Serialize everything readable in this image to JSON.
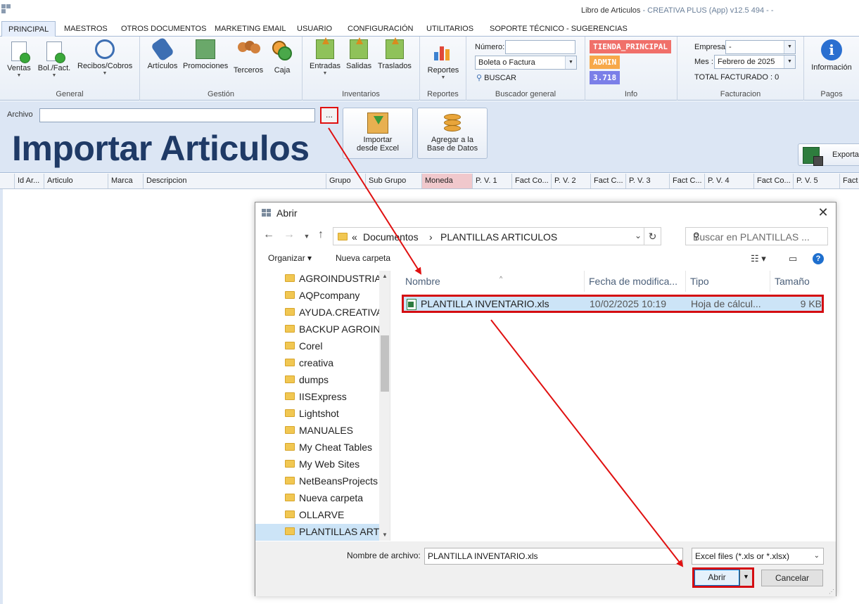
{
  "window": {
    "title": "Libro de Articulos",
    "subtitle": " - CREATIVA PLUS (App) v12.5 494 - -"
  },
  "tabs": [
    "PRINCIPAL",
    "MAESTROS",
    "OTROS DOCUMENTOS",
    "MARKETING EMAIL",
    "USUARIO",
    "CONFIGURACIÓN",
    "UTILITARIOS",
    "SOPORTE TÉCNICO - SUGERENCIAS"
  ],
  "ribbon": {
    "general": {
      "label": "General",
      "ventas": "Ventas",
      "bolfact": "Bol./Fact.",
      "recibos": "Recibos/Cobros"
    },
    "gestion": {
      "label": "Gestión",
      "articulos": "Artículos",
      "promociones": "Promociones",
      "terceros": "Terceros",
      "caja": "Caja"
    },
    "inventarios": {
      "label": "Inventarios",
      "entradas": "Entradas",
      "salidas": "Salidas",
      "traslados": "Traslados"
    },
    "reportes": {
      "label": "Reportes",
      "reportes_btn": "Reportes"
    },
    "buscador": {
      "label": "Buscador general",
      "numero_label": "Número:",
      "numero_value": "",
      "tipo_value": "Boleta o Factura",
      "buscar": "BUSCAR"
    },
    "info": {
      "label": "Info",
      "tienda": "TIENDA_PRINCIPAL",
      "user": "ADMIN",
      "value": "3.718",
      "colors": {
        "tienda": "#f0706a",
        "user": "#f7a84a",
        "value": "#7b7fe8"
      }
    },
    "facturacion": {
      "label": "Facturacion",
      "empresa_label": "Empresa",
      "empresa_value": "-",
      "mes_label": "Mes :",
      "mes_value": "Febrero de 2025",
      "total": "TOTAL FACTURADO : 0"
    },
    "pagos": {
      "label": "Pagos",
      "informacion": "Información"
    }
  },
  "import_panel": {
    "archivo_label": "Archivo",
    "archivo_value": "",
    "browse": "...",
    "title": "Importar Articulos",
    "importar_line1": "Importar",
    "importar_line2": "desde Excel",
    "agregar_line1": "Agregar a la",
    "agregar_line2": "Base de Datos",
    "exportar": "Exportar"
  },
  "grid_columns": [
    "Id Ar...",
    "Articulo",
    "Marca",
    "Descripcion",
    "Grupo",
    "Sub Grupo",
    "Moneda",
    "P. V. 1",
    "Fact Co...",
    "P. V. 2",
    "Fact C...",
    "P. V. 3",
    "Fact C...",
    "P. V. 4",
    "Fact Co...",
    "P. V. 5",
    "Fact"
  ],
  "dialog": {
    "title": "Abrir",
    "close": "✕",
    "address": {
      "prefix": "«",
      "part1": "Documentos",
      "sep": "›",
      "part2": "PLANTILLAS ARTICULOS"
    },
    "search_placeholder": "Buscar en PLANTILLAS ...",
    "organize": "Organizar ▾",
    "new_folder": "Nueva carpeta",
    "tree": [
      "AGROINDUSTRIA",
      "AQPcompany",
      "AYUDA.CREATIVA",
      "BACKUP AGROIN",
      "Corel",
      "creativa",
      "dumps",
      "IISExpress",
      "Lightshot",
      "MANUALES",
      "My Cheat Tables",
      "My Web Sites",
      "NetBeansProjects",
      "Nueva carpeta",
      "OLLARVE",
      "PLANTILLAS ARTI"
    ],
    "selected_folder": "PLANTILLAS ARTI",
    "columns": {
      "name": "Nombre",
      "date": "Fecha de modifica...",
      "type": "Tipo",
      "size": "Tamaño"
    },
    "file": {
      "name": "PLANTILLA INVENTARIO.xls",
      "date": "10/02/2025 10:19",
      "type": "Hoja de cálcul...",
      "size": "9 KB"
    },
    "filename_label": "Nombre de archivo:",
    "filename_value": "PLANTILLA INVENTARIO.xls",
    "filter": "Excel files (*.xls or *.xlsx)",
    "open": "Abrir",
    "cancel": "Cancelar"
  },
  "annotation_color": "#e01010"
}
